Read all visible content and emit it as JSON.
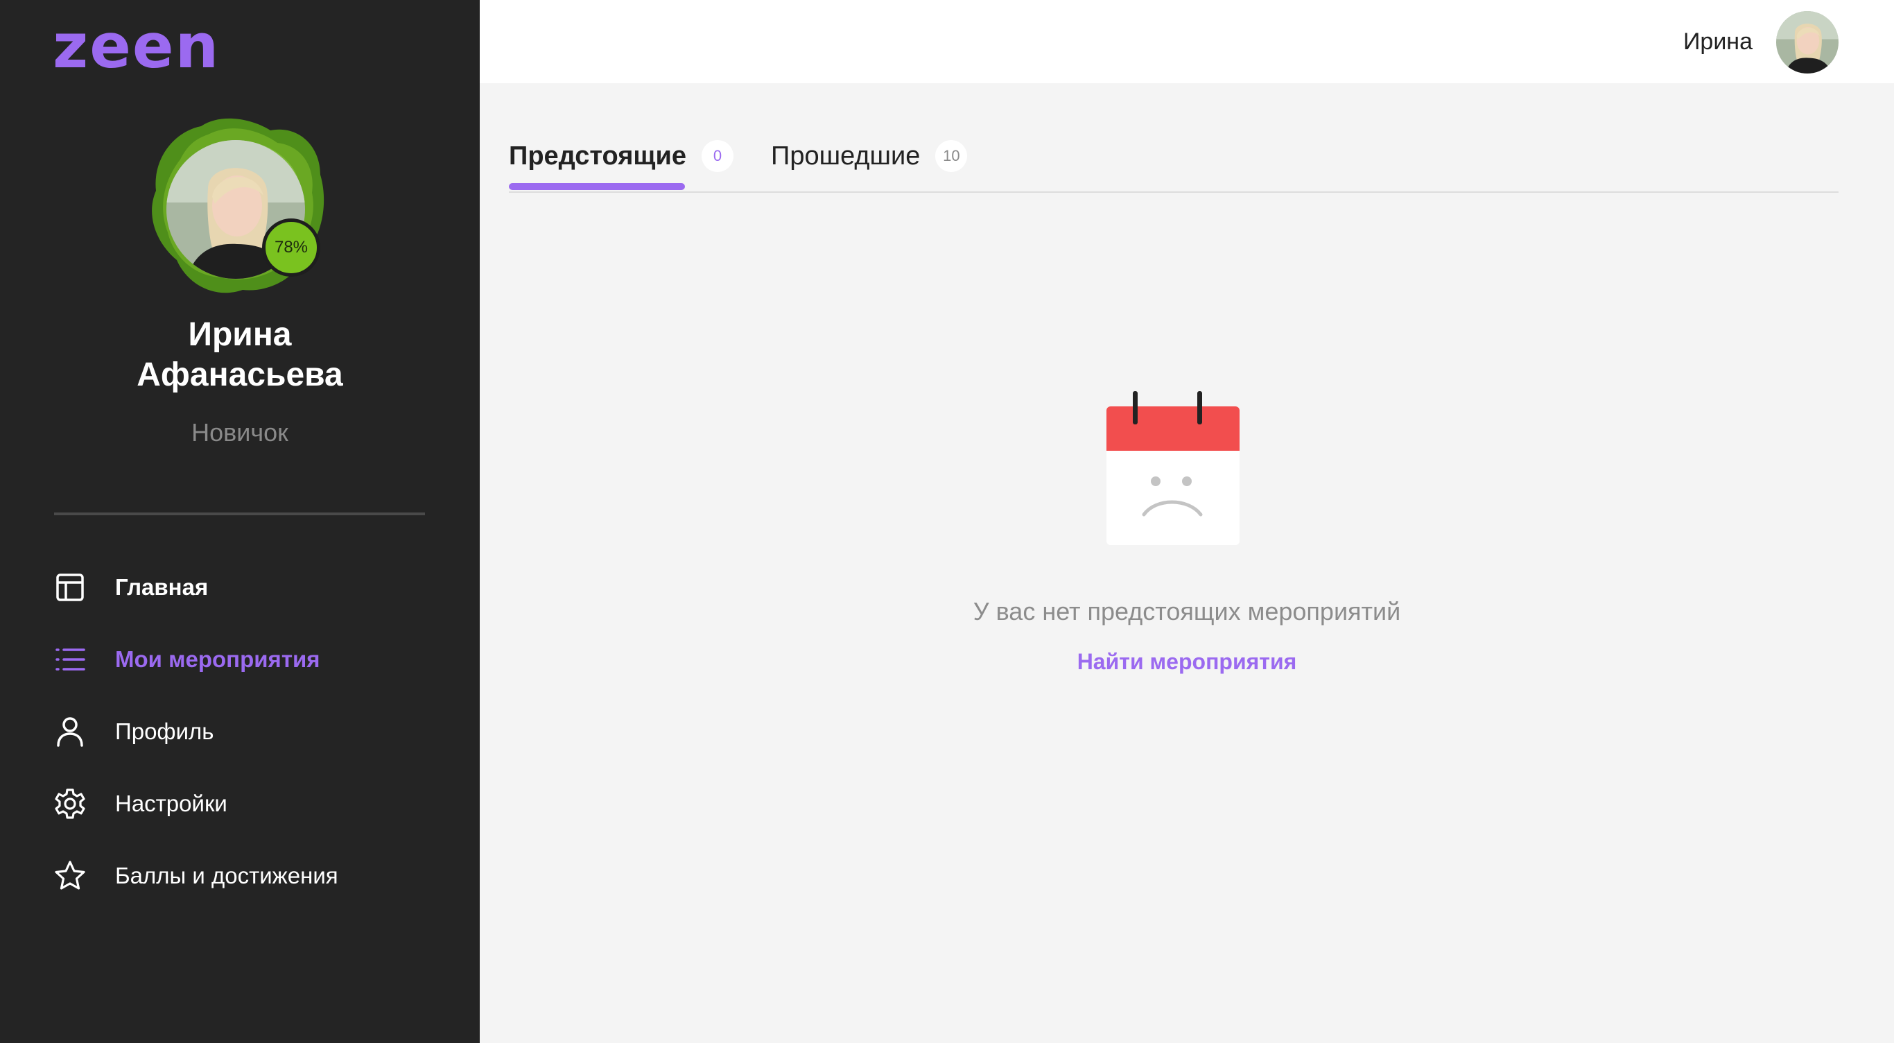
{
  "app": {
    "logo_text": "zeen",
    "brand_color": "#9b6af0"
  },
  "profile": {
    "name_line1": "Ирина",
    "name_line2": "Афанасьева",
    "level": "Новичок",
    "progress_label": "78%",
    "progress_percent": 78
  },
  "sidebar": {
    "items": [
      {
        "label": "Главная",
        "icon": "layout-icon",
        "active": false
      },
      {
        "label": "Мои мероприятия",
        "icon": "list-icon",
        "active": true
      },
      {
        "label": "Профиль",
        "icon": "user-icon",
        "active": false
      },
      {
        "label": "Настройки",
        "icon": "gear-icon",
        "active": false
      },
      {
        "label": "Баллы и достижения",
        "icon": "star-icon",
        "active": false
      }
    ]
  },
  "header": {
    "username": "Ирина",
    "avatar_icon": "user-avatar"
  },
  "tabs": [
    {
      "label": "Предстоящие",
      "count": "0",
      "active": true
    },
    {
      "label": "Прошедшие",
      "count": "10",
      "active": false
    }
  ],
  "empty_state": {
    "icon": "sad-calendar-icon",
    "message": "У вас нет предстоящих мероприятий",
    "link_label": "Найти мероприятия"
  },
  "colors": {
    "sidebar_bg": "#242424",
    "accent": "#9b6af0",
    "progress_green": "#7ac21f",
    "calendar_red": "#f24e4e"
  }
}
